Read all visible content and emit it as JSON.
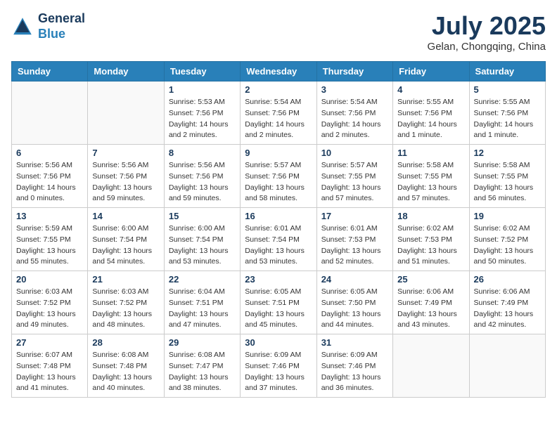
{
  "header": {
    "logo_line1": "General",
    "logo_line2": "Blue",
    "month_year": "July 2025",
    "location": "Gelan, Chongqing, China"
  },
  "weekdays": [
    "Sunday",
    "Monday",
    "Tuesday",
    "Wednesday",
    "Thursday",
    "Friday",
    "Saturday"
  ],
  "weeks": [
    [
      {
        "day": "",
        "info": ""
      },
      {
        "day": "",
        "info": ""
      },
      {
        "day": "1",
        "info": "Sunrise: 5:53 AM\nSunset: 7:56 PM\nDaylight: 14 hours and 2 minutes."
      },
      {
        "day": "2",
        "info": "Sunrise: 5:54 AM\nSunset: 7:56 PM\nDaylight: 14 hours and 2 minutes."
      },
      {
        "day": "3",
        "info": "Sunrise: 5:54 AM\nSunset: 7:56 PM\nDaylight: 14 hours and 2 minutes."
      },
      {
        "day": "4",
        "info": "Sunrise: 5:55 AM\nSunset: 7:56 PM\nDaylight: 14 hours and 1 minute."
      },
      {
        "day": "5",
        "info": "Sunrise: 5:55 AM\nSunset: 7:56 PM\nDaylight: 14 hours and 1 minute."
      }
    ],
    [
      {
        "day": "6",
        "info": "Sunrise: 5:56 AM\nSunset: 7:56 PM\nDaylight: 14 hours and 0 minutes."
      },
      {
        "day": "7",
        "info": "Sunrise: 5:56 AM\nSunset: 7:56 PM\nDaylight: 13 hours and 59 minutes."
      },
      {
        "day": "8",
        "info": "Sunrise: 5:56 AM\nSunset: 7:56 PM\nDaylight: 13 hours and 59 minutes."
      },
      {
        "day": "9",
        "info": "Sunrise: 5:57 AM\nSunset: 7:56 PM\nDaylight: 13 hours and 58 minutes."
      },
      {
        "day": "10",
        "info": "Sunrise: 5:57 AM\nSunset: 7:55 PM\nDaylight: 13 hours and 57 minutes."
      },
      {
        "day": "11",
        "info": "Sunrise: 5:58 AM\nSunset: 7:55 PM\nDaylight: 13 hours and 57 minutes."
      },
      {
        "day": "12",
        "info": "Sunrise: 5:58 AM\nSunset: 7:55 PM\nDaylight: 13 hours and 56 minutes."
      }
    ],
    [
      {
        "day": "13",
        "info": "Sunrise: 5:59 AM\nSunset: 7:55 PM\nDaylight: 13 hours and 55 minutes."
      },
      {
        "day": "14",
        "info": "Sunrise: 6:00 AM\nSunset: 7:54 PM\nDaylight: 13 hours and 54 minutes."
      },
      {
        "day": "15",
        "info": "Sunrise: 6:00 AM\nSunset: 7:54 PM\nDaylight: 13 hours and 53 minutes."
      },
      {
        "day": "16",
        "info": "Sunrise: 6:01 AM\nSunset: 7:54 PM\nDaylight: 13 hours and 53 minutes."
      },
      {
        "day": "17",
        "info": "Sunrise: 6:01 AM\nSunset: 7:53 PM\nDaylight: 13 hours and 52 minutes."
      },
      {
        "day": "18",
        "info": "Sunrise: 6:02 AM\nSunset: 7:53 PM\nDaylight: 13 hours and 51 minutes."
      },
      {
        "day": "19",
        "info": "Sunrise: 6:02 AM\nSunset: 7:52 PM\nDaylight: 13 hours and 50 minutes."
      }
    ],
    [
      {
        "day": "20",
        "info": "Sunrise: 6:03 AM\nSunset: 7:52 PM\nDaylight: 13 hours and 49 minutes."
      },
      {
        "day": "21",
        "info": "Sunrise: 6:03 AM\nSunset: 7:52 PM\nDaylight: 13 hours and 48 minutes."
      },
      {
        "day": "22",
        "info": "Sunrise: 6:04 AM\nSunset: 7:51 PM\nDaylight: 13 hours and 47 minutes."
      },
      {
        "day": "23",
        "info": "Sunrise: 6:05 AM\nSunset: 7:51 PM\nDaylight: 13 hours and 45 minutes."
      },
      {
        "day": "24",
        "info": "Sunrise: 6:05 AM\nSunset: 7:50 PM\nDaylight: 13 hours and 44 minutes."
      },
      {
        "day": "25",
        "info": "Sunrise: 6:06 AM\nSunset: 7:49 PM\nDaylight: 13 hours and 43 minutes."
      },
      {
        "day": "26",
        "info": "Sunrise: 6:06 AM\nSunset: 7:49 PM\nDaylight: 13 hours and 42 minutes."
      }
    ],
    [
      {
        "day": "27",
        "info": "Sunrise: 6:07 AM\nSunset: 7:48 PM\nDaylight: 13 hours and 41 minutes."
      },
      {
        "day": "28",
        "info": "Sunrise: 6:08 AM\nSunset: 7:48 PM\nDaylight: 13 hours and 40 minutes."
      },
      {
        "day": "29",
        "info": "Sunrise: 6:08 AM\nSunset: 7:47 PM\nDaylight: 13 hours and 38 minutes."
      },
      {
        "day": "30",
        "info": "Sunrise: 6:09 AM\nSunset: 7:46 PM\nDaylight: 13 hours and 37 minutes."
      },
      {
        "day": "31",
        "info": "Sunrise: 6:09 AM\nSunset: 7:46 PM\nDaylight: 13 hours and 36 minutes."
      },
      {
        "day": "",
        "info": ""
      },
      {
        "day": "",
        "info": ""
      }
    ]
  ]
}
